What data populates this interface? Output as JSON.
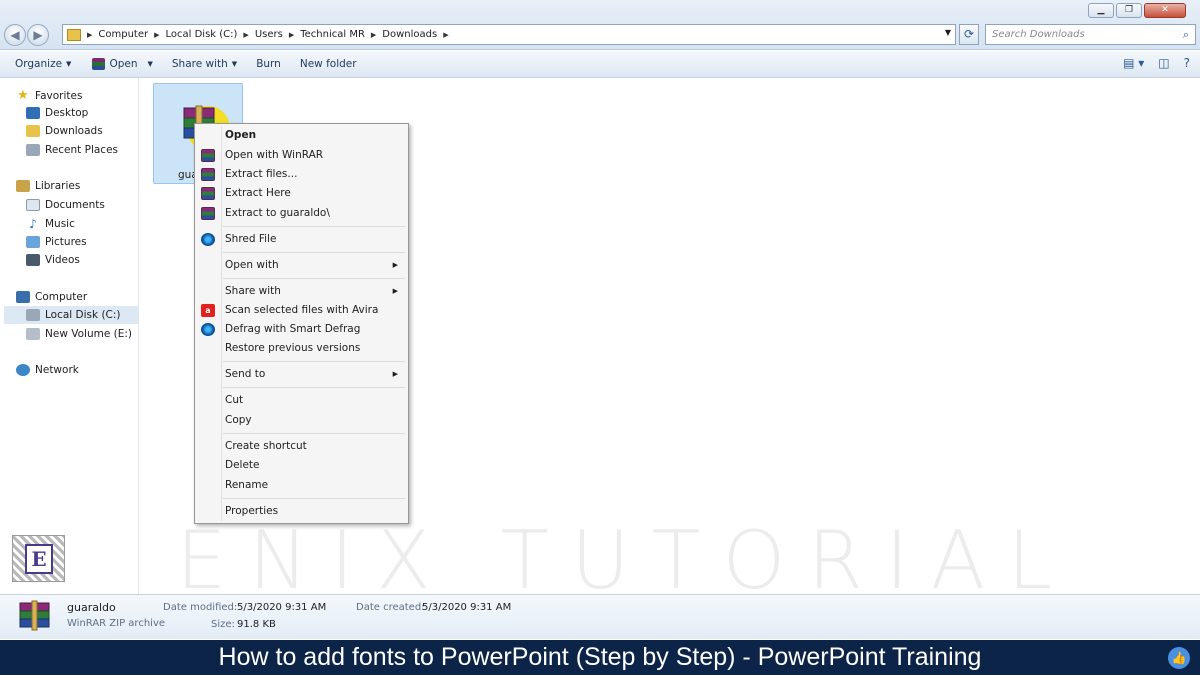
{
  "window": {
    "minimize": "▁",
    "maximize": "❐",
    "close": "✕"
  },
  "address": {
    "crumbs": [
      "Computer",
      "Local Disk (C:)",
      "Users",
      "Technical MR",
      "Downloads"
    ],
    "search_placeholder": "Search Downloads"
  },
  "toolbar": {
    "organize": "Organize",
    "open": "Open",
    "share_with": "Share with",
    "burn": "Burn",
    "new_folder": "New folder"
  },
  "nav": {
    "favorites": "Favorites",
    "desktop": "Desktop",
    "downloads": "Downloads",
    "recent_places": "Recent Places",
    "libraries": "Libraries",
    "documents": "Documents",
    "music": "Music",
    "pictures": "Pictures",
    "videos": "Videos",
    "computer": "Computer",
    "local_disk": "Local Disk (C:)",
    "new_volume": "New Volume (E:)",
    "network": "Network"
  },
  "file": {
    "name_partial": "gua"
  },
  "context_menu": {
    "open": "Open",
    "open_with_winrar": "Open with WinRAR",
    "extract_files": "Extract files...",
    "extract_here": "Extract Here",
    "extract_to": "Extract to guaraldo\\",
    "shred_file": "Shred File",
    "open_with": "Open with",
    "share_with": "Share with",
    "scan_avira": "Scan selected files with Avira",
    "defrag": "Defrag with Smart Defrag",
    "restore": "Restore previous versions",
    "send_to": "Send to",
    "cut": "Cut",
    "copy": "Copy",
    "create_shortcut": "Create shortcut",
    "delete": "Delete",
    "rename": "Rename",
    "properties": "Properties"
  },
  "details": {
    "name": "guaraldo",
    "type": "WinRAR ZIP archive",
    "modified_label": "Date modified:",
    "modified_value": "5/3/2020 9:31 AM",
    "created_label": "Date created:",
    "created_value": "5/3/2020 9:31 AM",
    "size_label": "Size:",
    "size_value": "91.8 KB"
  },
  "watermark": "ENIX TUTORIAL",
  "logo_letter": "E",
  "caption": "How to add fonts to PowerPoint (Step by Step) - PowerPoint Training"
}
